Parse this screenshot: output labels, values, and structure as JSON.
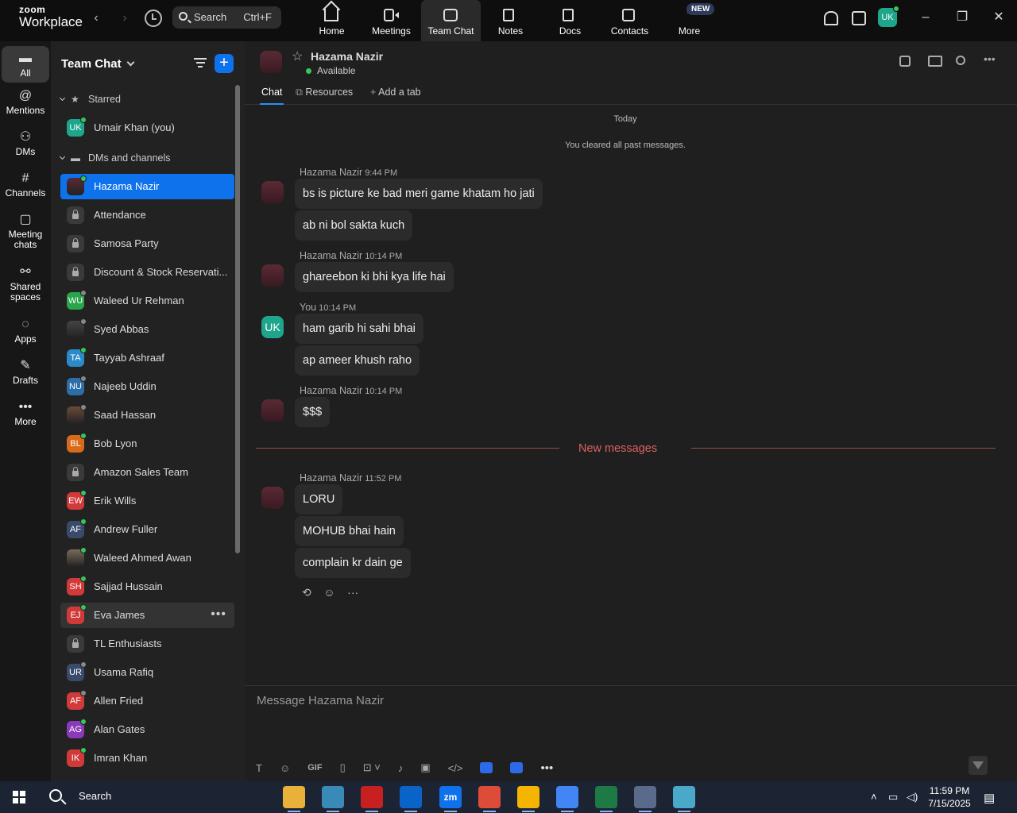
{
  "app": {
    "logo_small": "zoom",
    "logo_big": "Workplace"
  },
  "topbar": {
    "search_label": "Search",
    "search_shortcut": "Ctrl+F",
    "tabs": [
      {
        "label": "Home",
        "icon": "home-icon"
      },
      {
        "label": "Meetings",
        "icon": "video-camera-icon"
      },
      {
        "label": "Team Chat",
        "icon": "chat-bubbles-icon",
        "active": true
      },
      {
        "label": "Notes",
        "icon": "notes-icon"
      },
      {
        "label": "Docs",
        "icon": "docs-icon"
      },
      {
        "label": "Contacts",
        "icon": "contacts-icon"
      },
      {
        "label": "More",
        "icon": "more-dots-icon"
      }
    ],
    "new_badge": "NEW",
    "avatar_initials": "UK"
  },
  "rail": [
    {
      "label": "All",
      "icon": "chat-icon",
      "active": true
    },
    {
      "label": "Mentions",
      "icon": "at-icon"
    },
    {
      "label": "DMs",
      "icon": "people-icon"
    },
    {
      "label": "Channels",
      "icon": "hash-icon"
    },
    {
      "label": "Meeting chats",
      "icon": "calendar-icon"
    },
    {
      "label": "Shared spaces",
      "icon": "share-icon"
    },
    {
      "label": "Apps",
      "icon": "apps-icon"
    },
    {
      "label": "Drafts",
      "icon": "edit-icon"
    },
    {
      "label": "More",
      "icon": "more-dots-icon"
    }
  ],
  "sidebar": {
    "title": "Team Chat",
    "starred_label": "Starred",
    "dms_label": "DMs and channels",
    "starred": [
      {
        "name": "Umair Khan (you)",
        "initials": "UK",
        "color": "#1fa58b",
        "status": "#35c759"
      }
    ],
    "items": [
      {
        "name": "Hazama Nazir",
        "type": "photo",
        "color": "#5a2a35",
        "status": "#35c759",
        "selected": true
      },
      {
        "name": "Attendance",
        "type": "lock"
      },
      {
        "name": "Samosa Party",
        "type": "lock"
      },
      {
        "name": "Discount & Stock Reservati...",
        "type": "lock"
      },
      {
        "name": "Waleed Ur Rehman",
        "initials": "WU",
        "color": "#2aa54a",
        "status": "#888888"
      },
      {
        "name": "Syed Abbas",
        "type": "photo",
        "color": "#444444",
        "status": "#888888"
      },
      {
        "name": "Tayyab Ashraaf",
        "initials": "TA",
        "color": "#2c8ac9",
        "status": "#35c759"
      },
      {
        "name": "Najeeb Uddin",
        "initials": "NU",
        "color": "#2d6ea8",
        "status": "#888888"
      },
      {
        "name": "Saad Hassan",
        "type": "photo",
        "color": "#6a4a3a",
        "status": "#888888"
      },
      {
        "name": "Bob Lyon",
        "initials": "BL",
        "color": "#d86a1a",
        "status": "#35c759"
      },
      {
        "name": "Amazon Sales Team",
        "type": "lock"
      },
      {
        "name": "Erik Wills",
        "initials": "EW",
        "color": "#d23a3a",
        "status": "#35c759"
      },
      {
        "name": "Andrew Fuller",
        "initials": "AF",
        "color": "#3a4a6a",
        "status": "#35c759"
      },
      {
        "name": "Waleed Ahmed Awan",
        "type": "photo",
        "color": "#7a6a5a",
        "status": "#35c759"
      },
      {
        "name": "Sajjad Hussain",
        "initials": "SH",
        "color": "#d23a3a",
        "status": "#35c759"
      },
      {
        "name": "Eva James",
        "initials": "EJ",
        "color": "#d23a3a",
        "status": "#35c759",
        "hover": true
      },
      {
        "name": "TL Enthusiasts",
        "type": "lock"
      },
      {
        "name": "Usama Rafiq",
        "initials": "UR",
        "color": "#3a4a6a",
        "status": "#888888"
      },
      {
        "name": "Allen Fried",
        "initials": "AF",
        "color": "#d23a3a",
        "status": "#888888"
      },
      {
        "name": "Alan Gates",
        "initials": "AG",
        "color": "#8a3ab8",
        "status": "#35c759"
      },
      {
        "name": "Imran Khan",
        "initials": "IK",
        "color": "#d23a3a",
        "status": "#35c759"
      }
    ]
  },
  "chat": {
    "contact_name": "Hazama Nazir",
    "contact_status": "Available",
    "tabs": [
      "Chat",
      "Resources",
      "Add a tab"
    ],
    "day_label": "Today",
    "cleared_note": "You cleared all past messages.",
    "groups": [
      {
        "sender": "Hazama Nazir",
        "time": "9:44 PM",
        "me": false,
        "messages": [
          "bs is picture ke bad meri game khatam ho jati",
          "ab ni bol sakta kuch"
        ]
      },
      {
        "sender": "Hazama Nazir",
        "time": "10:14 PM",
        "me": false,
        "messages": [
          "ghareebon ki bhi kya life hai"
        ]
      },
      {
        "sender": "You",
        "time": "10:14 PM",
        "me": true,
        "initials": "UK",
        "messages": [
          "ham garib hi sahi bhai",
          "ap ameer khush raho"
        ]
      },
      {
        "sender": "Hazama Nazir",
        "time": "10:14 PM",
        "me": false,
        "messages": [
          "$$$"
        ]
      },
      {
        "sender": "Hazama Nazir",
        "time": "11:52 PM",
        "me": false,
        "messages": [
          "LORU",
          "MOHUB bhai hain",
          "complain kr dain ge"
        ]
      }
    ],
    "new_messages_label": "New messages",
    "composer_placeholder": "Message Hazama Nazir"
  },
  "taskbar": {
    "search_label": "Search",
    "time": "11:59 PM",
    "date": "7/15/2025",
    "apps": [
      {
        "name": "file-explorer",
        "color": "#e8b23a"
      },
      {
        "name": "app-blue",
        "color": "#3a8ab8"
      },
      {
        "name": "filezilla",
        "color": "#c82020"
      },
      {
        "name": "outlook",
        "color": "#0a64c8"
      },
      {
        "name": "zoom",
        "color": "#0e72ed",
        "label": "zm"
      },
      {
        "name": "chrome-1",
        "color": "#dd4b39"
      },
      {
        "name": "chrome-2",
        "color": "#f4b400"
      },
      {
        "name": "chrome-3",
        "color": "#4285f4"
      },
      {
        "name": "excel",
        "color": "#1d7a44"
      },
      {
        "name": "calculator",
        "color": "#5a6a8a"
      },
      {
        "name": "notes-app",
        "color": "#4aa8c8"
      }
    ]
  }
}
